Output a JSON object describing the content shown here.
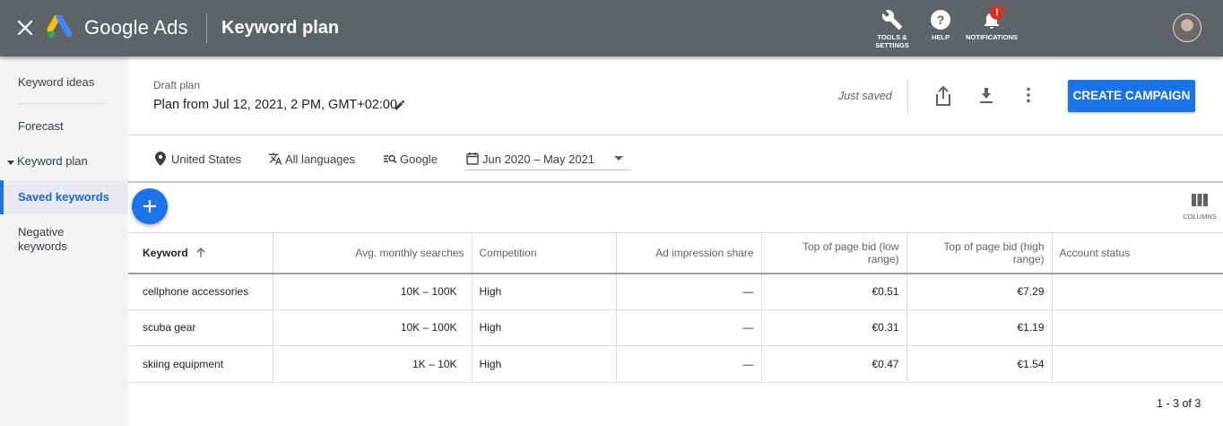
{
  "header": {
    "brand": "Google Ads",
    "page_title": "Keyword plan",
    "tools_label": "TOOLS &",
    "tools_label_2": "SETTINGS",
    "help_label": "HELP",
    "notifications_label": "NOTIFICATIONS",
    "notifications_badge": "!"
  },
  "sidebar": {
    "items": [
      {
        "label": "Keyword ideas"
      },
      {
        "label": "Forecast"
      },
      {
        "label": "Keyword plan"
      },
      {
        "label": "Saved keywords"
      },
      {
        "label": "Negative keywords"
      }
    ]
  },
  "plan": {
    "status_label": "Draft plan",
    "name": "Plan from Jul 12, 2021, 2 PM, GMT+02:00",
    "save_state": "Just saved",
    "create_button": "CREATE CAMPAIGN"
  },
  "filters": {
    "location": "United States",
    "language": "All languages",
    "network": "Google",
    "date_range": "Jun 2020 – May 2021"
  },
  "toolbar": {
    "columns_label": "COLUMNS"
  },
  "table": {
    "columns": [
      "Keyword",
      "Avg. monthly searches",
      "Competition",
      "Ad impression share",
      "Top of page bid (low range)",
      "Top of page bid (high range)",
      "Account status"
    ],
    "rows": [
      {
        "keyword": "cellphone accessories",
        "searches": "10K – 100K",
        "competition": "High",
        "impression_share": "—",
        "bid_low": "€0.51",
        "bid_high": "€7.29",
        "status": ""
      },
      {
        "keyword": "scuba gear",
        "searches": "10K – 100K",
        "competition": "High",
        "impression_share": "—",
        "bid_low": "€0.31",
        "bid_high": "€1.19",
        "status": ""
      },
      {
        "keyword": "skiing equipment",
        "searches": "1K – 10K",
        "competition": "High",
        "impression_share": "—",
        "bid_low": "€0.47",
        "bid_high": "€1.54",
        "status": ""
      }
    ],
    "pagination": "1 - 3 of 3"
  },
  "colors": {
    "topbar": "#5f6368",
    "accent": "#1a73e8",
    "badge": "#d93025"
  }
}
